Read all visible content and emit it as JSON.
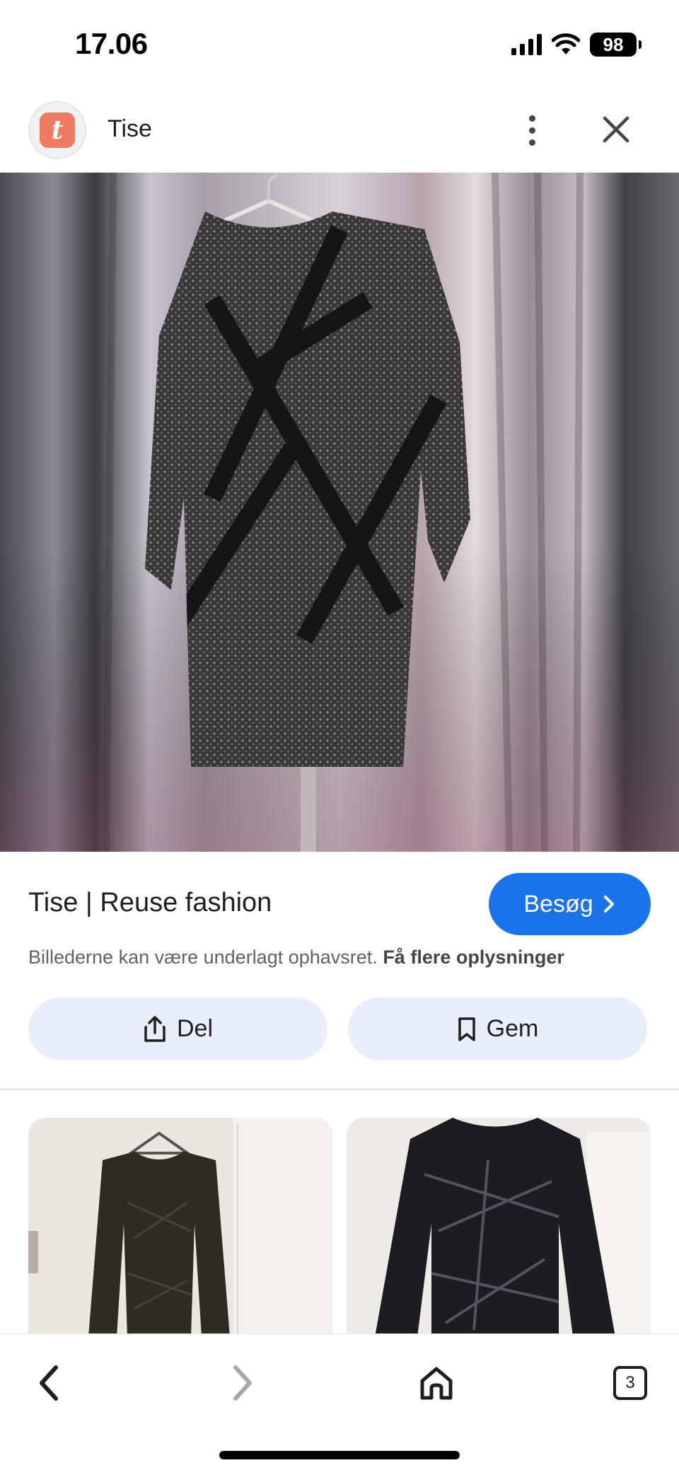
{
  "status_bar": {
    "time": "17.06",
    "battery": "98"
  },
  "header": {
    "logo_letter": "t",
    "site_name": "Tise"
  },
  "result": {
    "title": "Tise | Reuse fashion",
    "visit_label": "Besøg",
    "copyright_text": "Billederne kan være underlagt ophavsret.",
    "more_info_link": "Få flere oplysninger"
  },
  "actions": {
    "share_label": "Del",
    "save_label": "Gem"
  },
  "bottom_nav": {
    "tab_count": "3"
  },
  "colors": {
    "accent": "#1a73e8",
    "logo": "#f07a5f",
    "action_bg": "#e8effb"
  },
  "icons": [
    "more-vert-icon",
    "close-icon",
    "chevron-right-icon",
    "share-icon",
    "bookmark-icon",
    "back-arrow-icon",
    "forward-arrow-icon",
    "home-icon",
    "tabs-icon",
    "wifi-icon",
    "signal-icon",
    "battery-icon"
  ]
}
